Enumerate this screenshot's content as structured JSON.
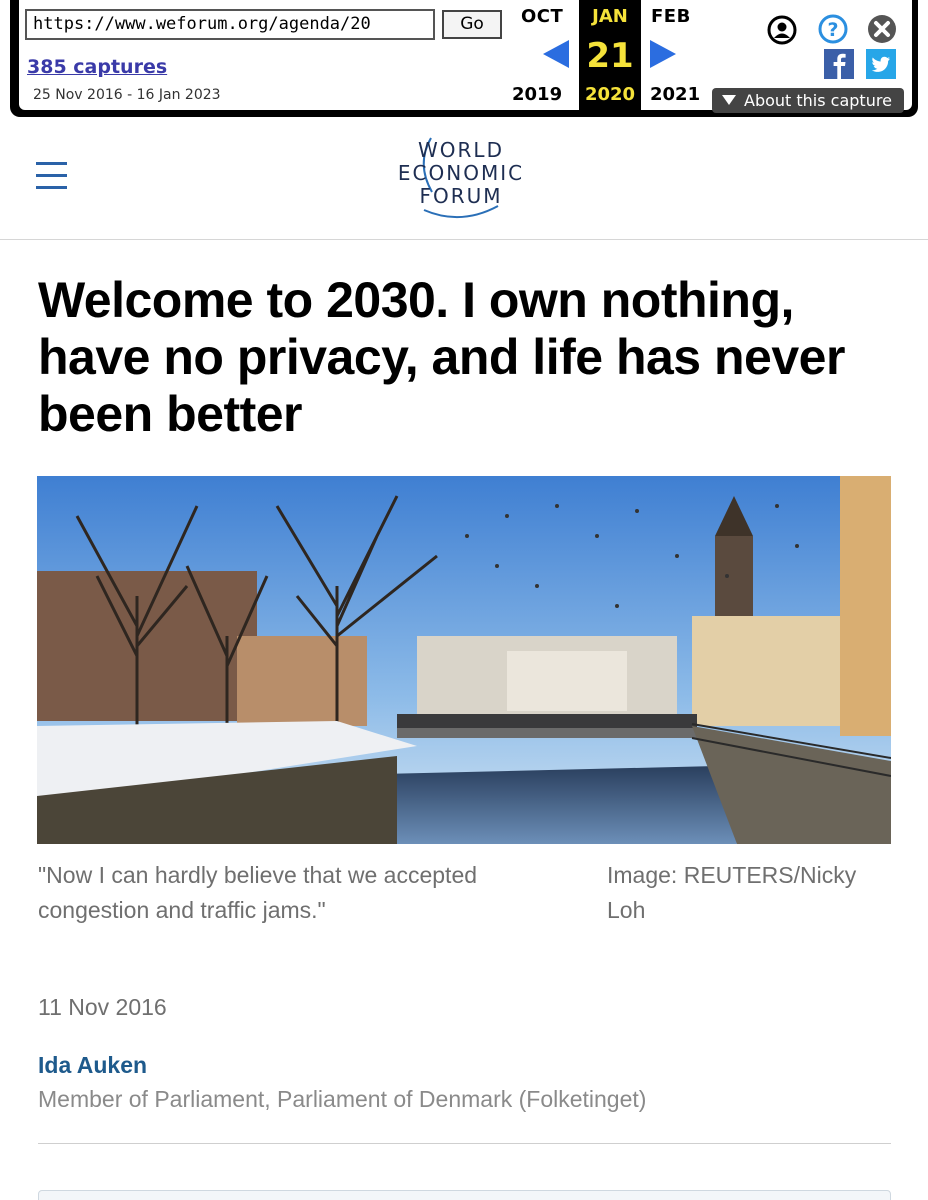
{
  "wayback": {
    "url": "https://www.weforum.org/agenda/20",
    "go_label": "Go",
    "captures": "385 captures",
    "date_range": "25 Nov 2016 - 16 Jan 2023",
    "prev_month": "OCT",
    "current_month": "JAN",
    "next_month": "FEB",
    "current_day": "21",
    "prev_year": "2019",
    "current_year": "2020",
    "next_year": "2021",
    "about_label": "About this capture",
    "accent_color": "#2b6de0",
    "highlight_color": "#f5e23a",
    "icons": [
      "user-icon",
      "help-icon",
      "close-icon",
      "facebook-icon",
      "twitter-icon",
      "prev-arrow-icon",
      "next-arrow-icon"
    ]
  },
  "header": {
    "menu_icon": "hamburger-menu-icon",
    "logo_lines": [
      "WORLD",
      "ECONOMIC",
      "FORUM"
    ],
    "brand_color": "#1e2e52"
  },
  "article": {
    "headline": "Welcome to 2030. I own nothing, have no privacy, and life has never been better",
    "caption": "\"Now I can hardly believe that we accepted congestion and traffic jams.\"",
    "credit": "Image: REUTERS/Nicky Loh",
    "date": "11 Nov 2016",
    "author": "Ida Auken",
    "author_role": "Member of Parliament, Parliament of Denmark (Folketinget)",
    "author_color": "#1e5a8c"
  }
}
